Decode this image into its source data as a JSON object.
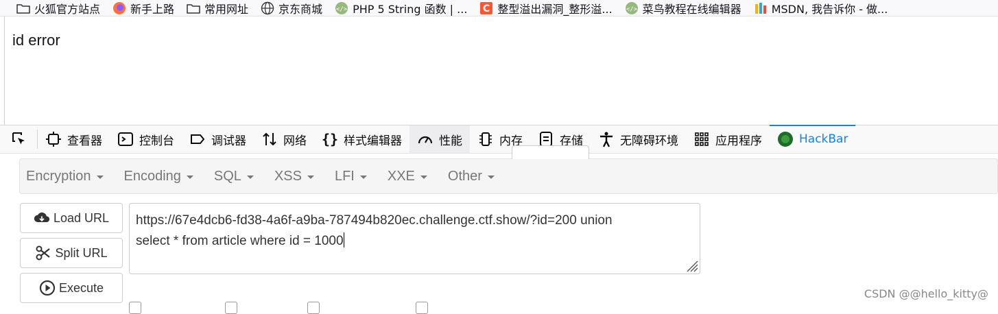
{
  "bookmarks": [
    {
      "label": "火狐官方站点",
      "icon": "folder-icon"
    },
    {
      "label": "新手上路",
      "icon": "firefox-icon"
    },
    {
      "label": "常用网址",
      "icon": "folder-icon"
    },
    {
      "label": "京东商城",
      "icon": "globe-icon"
    },
    {
      "label": "PHP 5 String 函数 | ...",
      "icon": "runoob-icon"
    },
    {
      "label": "整型溢出漏洞_整形溢...",
      "icon": "csdn-icon"
    },
    {
      "label": "菜鸟教程在线编辑器",
      "icon": "runoob-icon"
    },
    {
      "label": "MSDN, 我告诉你 - 做...",
      "icon": "msdn-icon"
    }
  ],
  "page": {
    "text": "id error"
  },
  "devtools": {
    "tabs": [
      {
        "label": "查看器",
        "icon": "inspector-icon"
      },
      {
        "label": "控制台",
        "icon": "console-icon"
      },
      {
        "label": "调试器",
        "icon": "debugger-icon"
      },
      {
        "label": "网络",
        "icon": "network-icon"
      },
      {
        "label": "样式编辑器",
        "icon": "style-editor-icon"
      },
      {
        "label": "性能",
        "icon": "performance-icon"
      },
      {
        "label": "内存",
        "icon": "memory-icon"
      },
      {
        "label": "存储",
        "icon": "storage-icon"
      },
      {
        "label": "无障碍环境",
        "icon": "accessibility-icon"
      },
      {
        "label": "应用程序",
        "icon": "application-icon"
      },
      {
        "label": "HackBar",
        "icon": "hackbar-icon"
      }
    ],
    "accent": "#0a84ff"
  },
  "hackbar": {
    "menus": [
      "Encryption",
      "Encoding",
      "SQL",
      "XSS",
      "LFI",
      "XXE",
      "Other"
    ],
    "buttons": {
      "load": "Load URL",
      "split": "Split URL",
      "execute": "Execute"
    },
    "url_line1": "https://67e4dcb6-fd38-4a6f-a9ba-787494b820ec.challenge.ctf.show/?id=200 union",
    "url_line2": "select * from article where id = 1000"
  },
  "watermark": "CSDN @@hello_kitty@"
}
